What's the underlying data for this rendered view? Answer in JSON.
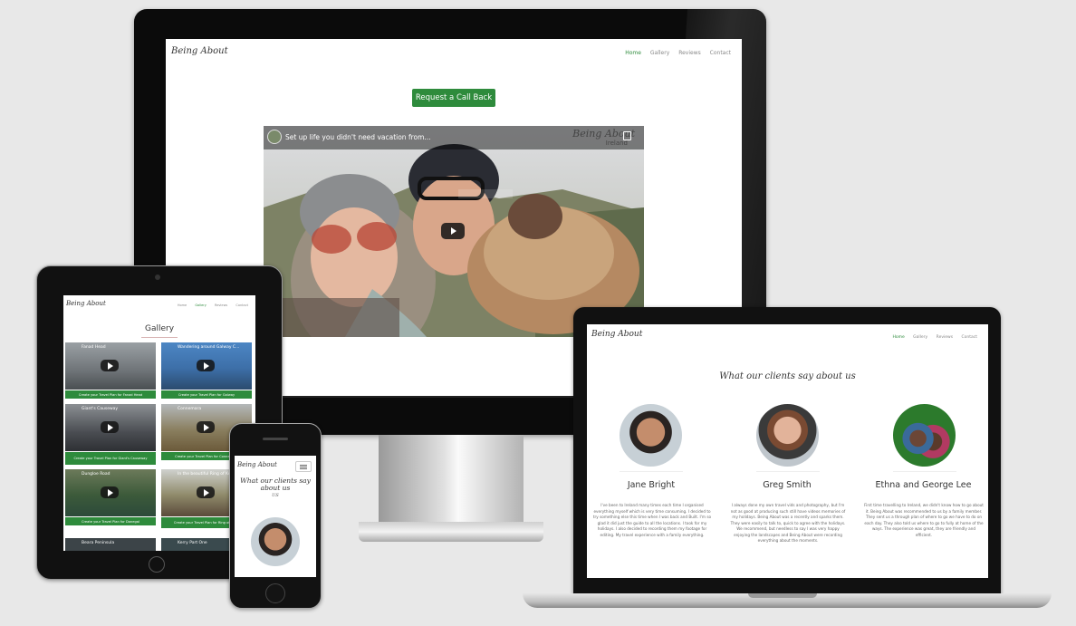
{
  "brand": {
    "logo_text": "Being About",
    "accent_color": "#2e8b3c"
  },
  "nav": {
    "items": [
      "Home",
      "Gallery",
      "Reviews",
      "Contact"
    ],
    "active": "Home"
  },
  "desktop": {
    "cta_label": "Request a Call Back",
    "video": {
      "title": "Set up life you didn't need vacation from...",
      "watermark": "Being About",
      "watermark_sub": "Ireland"
    }
  },
  "tablet": {
    "heading": "Gallery",
    "cards": [
      {
        "video_title": "Fanad Head",
        "button": "Create your Travel Plan for Fanad Head"
      },
      {
        "video_title": "Wandering around Galway C...",
        "button": "Create your Travel Plan for Galway"
      },
      {
        "video_title": "Giant's Causeway",
        "button": "Create your Travel Plan for Giant's Causeway"
      },
      {
        "video_title": "Connemara",
        "button": "Create your Travel Plan for Connemara"
      },
      {
        "video_title": "Dungloe Road",
        "button": "Create your Travel Plan for Donegal"
      },
      {
        "video_title": "In the beautiful Ring of Kerry",
        "button": "Create your Travel Plan for Ring of Kerry"
      },
      {
        "video_title": "Beara Peninsula",
        "button": ""
      },
      {
        "video_title": "Kerry Part One",
        "button": ""
      }
    ]
  },
  "laptop": {
    "heading": "What our clients say about us",
    "reviews": [
      {
        "name": "Jane Bright",
        "text": "I've been to Ireland many times each time I organised everything myself which is very time consuming. I decided to try something else this time when I was back and Built. I'm so glad it did just the guide to all the locations. I took for my holidays. I also decided to recording them my footage for editing. My travel experience with a family everything."
      },
      {
        "name": "Greg Smith",
        "text": "I always done my own travel vids and photography, but I'm not as good at producing such still have videos memories of my holidays. Being About was a recently and sparks them. They were easily to talk to, quick to agree with the holidays. We recommend, but needless to say I was very happy enjoying the landscapes and Being About were recording everything about the moments."
      },
      {
        "name": "Ethna and George Lee",
        "text": "First time travelling to Ireland, we didn't know how to go about it. Being About was recommended to us by a family member. They sent us a through plan of where to go we have to do on each day. They also told us where to go to fully at home of the ways. The experience was great, they are friendly and efficient."
      }
    ]
  },
  "phone": {
    "heading": "What our clients say about us",
    "subheading": "US"
  },
  "icons": {
    "play": "play-icon",
    "menu": "hamburger-menu-icon",
    "copy": "copy-icon",
    "channel": "channel-avatar-icon"
  }
}
